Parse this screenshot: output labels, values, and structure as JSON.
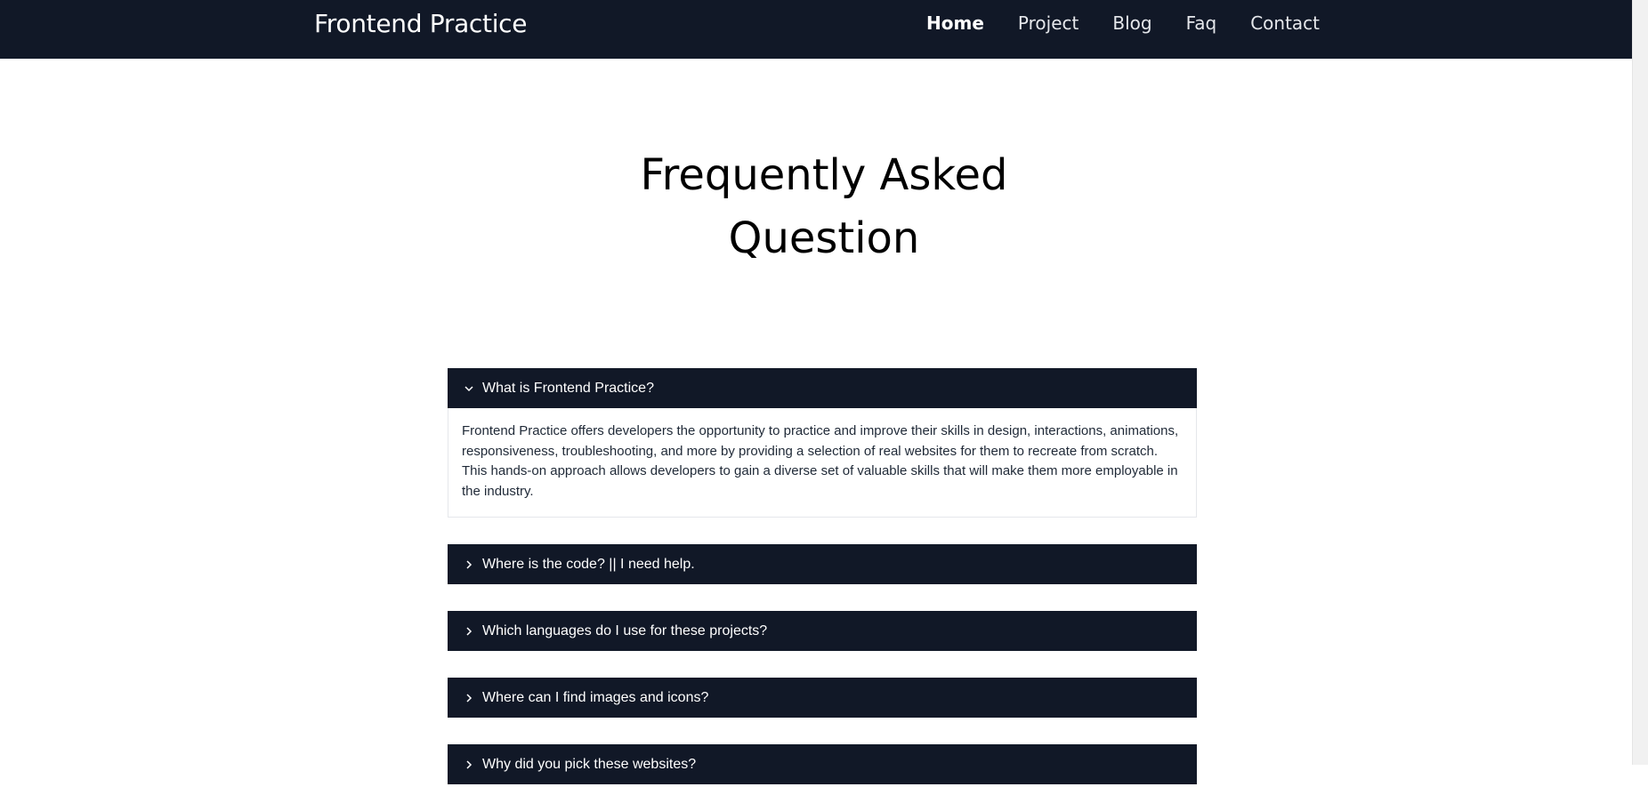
{
  "brand": "Frontend Practice",
  "nav": {
    "items": [
      {
        "label": "Home",
        "active": true
      },
      {
        "label": "Project",
        "active": false
      },
      {
        "label": "Blog",
        "active": false
      },
      {
        "label": "Faq",
        "active": false
      },
      {
        "label": "Contact",
        "active": false
      }
    ]
  },
  "page": {
    "title_line1": "Frequently Asked",
    "title_line2": "Question"
  },
  "faq": {
    "items": [
      {
        "question": "What is Frontend Practice?",
        "expanded": true,
        "answer": "Frontend Practice offers developers the opportunity to practice and improve their skills in design, interactions, animations, responsiveness, troubleshooting, and more by providing a selection of real websites for them to recreate from scratch. This hands-on approach allows developers to gain a diverse set of valuable skills that will make them more employable in the industry."
      },
      {
        "question": "Where is the code? || I need help.",
        "expanded": false
      },
      {
        "question": "Which languages do I use for these projects?",
        "expanded": false
      },
      {
        "question": "Where can I find images and icons?",
        "expanded": false
      },
      {
        "question": "Why did you pick these websites?",
        "expanded": false
      }
    ]
  },
  "colors": {
    "navbar_bg": "#111827",
    "accordion_bg": "#111827",
    "body_text": "#1f2937"
  }
}
